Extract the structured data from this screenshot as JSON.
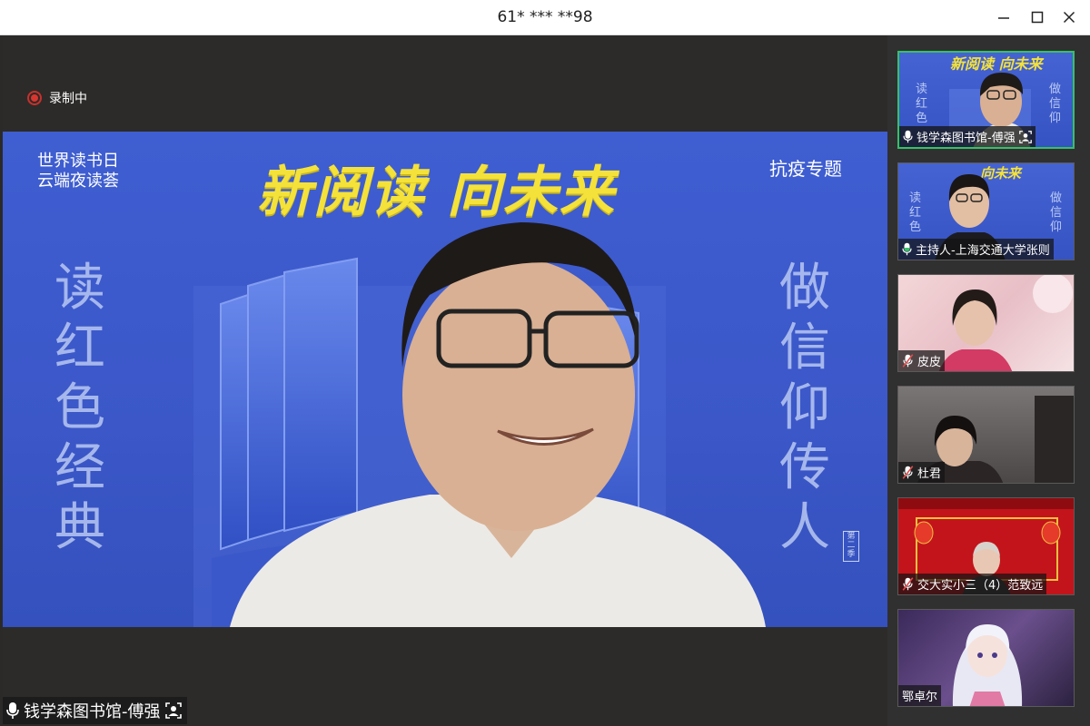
{
  "window": {
    "title": "61* *** **98"
  },
  "recording": {
    "label": "录制中",
    "color": "#d9362f"
  },
  "video": {
    "top_left_line1": "世界读书日",
    "top_left_line2": "云端夜读荟",
    "slogan": "新阅读 向未来",
    "top_right": "抗疫专题",
    "left_vertical": [
      "读",
      "红",
      "色",
      "经",
      "典"
    ],
    "right_vertical": [
      "做",
      "信",
      "仰",
      "传",
      "人"
    ],
    "stamp": "第二季"
  },
  "speaker_bar": {
    "name": "钱学森图书馆-傅强"
  },
  "participants": [
    {
      "name": "钱学森图书馆-傅强",
      "mic": "mic-on",
      "active": true
    },
    {
      "name": "主持人-上海交通大学张则",
      "mic": "mic-on",
      "active": false
    },
    {
      "name": "皮皮",
      "mic": "mic-muted",
      "active": false
    },
    {
      "name": "杜君",
      "mic": "mic-muted",
      "active": false
    },
    {
      "name": "交大实小三（4）范致远",
      "mic": "mic-muted",
      "active": false
    },
    {
      "name": "鄂卓尔",
      "mic": "none",
      "active": false
    }
  ],
  "colors": {
    "accent": "#2f7bef",
    "active_border": "#34c266",
    "slogan": "#f4e23a",
    "video_bg": "#3f5ed1"
  }
}
